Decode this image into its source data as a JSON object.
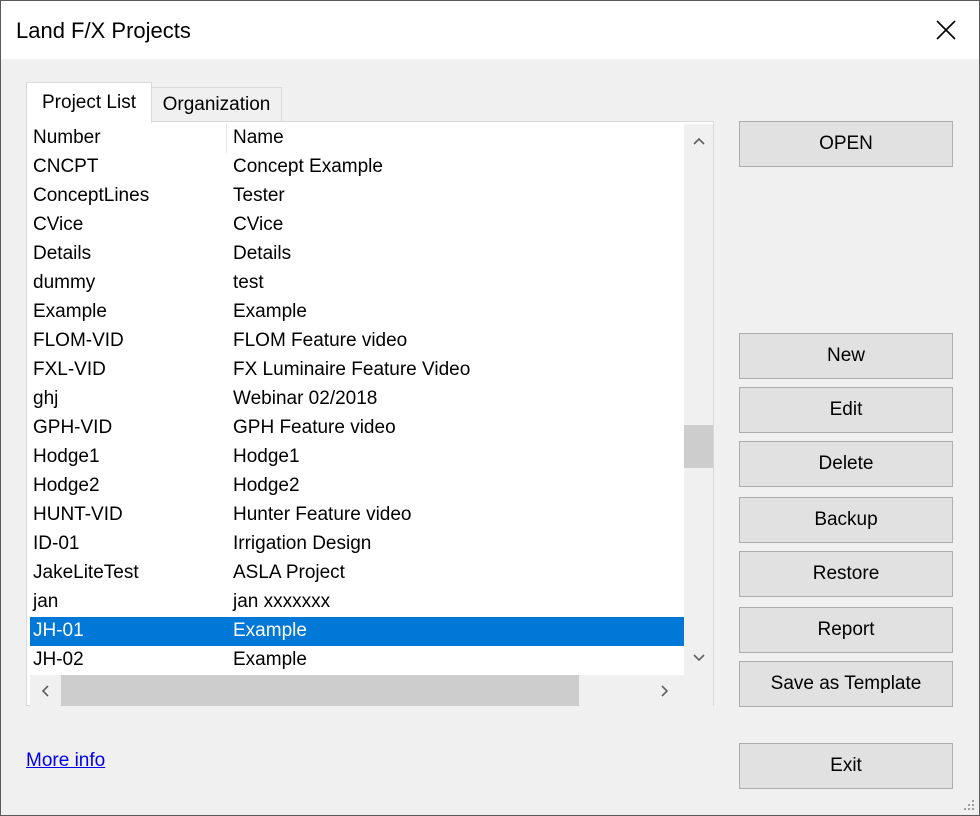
{
  "window": {
    "title": "Land F/X Projects"
  },
  "tabs": [
    {
      "label": "Project List",
      "active": true
    },
    {
      "label": "Organization",
      "active": false
    }
  ],
  "list": {
    "columns": [
      "Number",
      "Name"
    ],
    "rows": [
      {
        "number": "CNCPT",
        "name": "Concept Example"
      },
      {
        "number": "ConceptLines",
        "name": "Tester"
      },
      {
        "number": "CVice",
        "name": "CVice"
      },
      {
        "number": "Details",
        "name": "Details"
      },
      {
        "number": "dummy",
        "name": "test"
      },
      {
        "number": "Example",
        "name": "Example"
      },
      {
        "number": "FLOM-VID",
        "name": "FLOM Feature video"
      },
      {
        "number": "FXL-VID",
        "name": "FX Luminaire Feature Video"
      },
      {
        "number": "ghj",
        "name": "Webinar 02/2018"
      },
      {
        "number": "GPH-VID",
        "name": "GPH Feature video"
      },
      {
        "number": "Hodge1",
        "name": "Hodge1"
      },
      {
        "number": "Hodge2",
        "name": "Hodge2"
      },
      {
        "number": "HUNT-VID",
        "name": "Hunter Feature video"
      },
      {
        "number": "ID-01",
        "name": "Irrigation Design"
      },
      {
        "number": "JakeLiteTest",
        "name": "ASLA Project"
      },
      {
        "number": "jan",
        "name": "jan xxxxxxx"
      },
      {
        "number": "JH-01",
        "name": "Example",
        "selected": true
      },
      {
        "number": "JH-02",
        "name": "Example"
      }
    ]
  },
  "buttons": {
    "open": "OPEN",
    "new": "New",
    "edit": "Edit",
    "delete": "Delete",
    "backup": "Backup",
    "restore": "Restore",
    "report": "Report",
    "save_template": "Save as Template",
    "exit": "Exit"
  },
  "links": {
    "more_info": "More info"
  },
  "colors": {
    "selection": "#0078d7",
    "link": "#0000ee"
  }
}
